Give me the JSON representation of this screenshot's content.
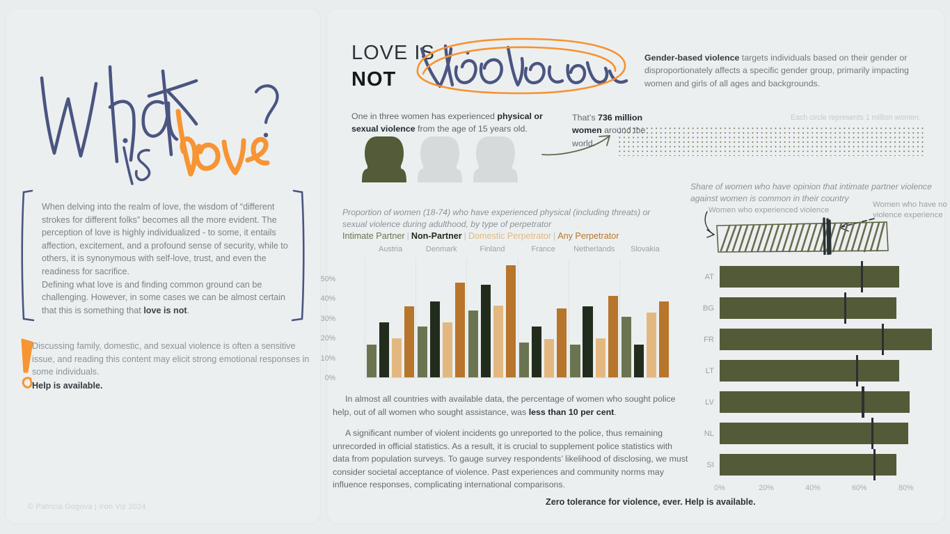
{
  "left_panel": {
    "headline_words": [
      "What",
      "is",
      "love?"
    ],
    "body_paragraph_1": "When delving into the realm of love, the wisdom of “different strokes for different folks” becomes all the more evident. The perception of love is highly individualized - to some, it entails affection, excitement, and a profound sense of security, while to others, it is synonymous with self-love, trust, and even the readiness for sacrifice.",
    "body_paragraph_2_lead": "Defining what love is and finding common ground can be challenging. However, in some cases we can be almost certain that this is something that ",
    "body_paragraph_2_bold": "love is not",
    "body_paragraph_2_tail": ".",
    "warning_text": "Discussing family, domestic, and sexual violence is often a sensitive issue, and reading this content may elicit strong emotional responses in some individuals.",
    "warning_strong": "Help is available.",
    "credit": "© Patricia Gogova | Iron Viz 2024"
  },
  "header": {
    "title_line1": "LOVE IS",
    "title_line2": "NOT",
    "title_script": "violence",
    "gbv_bold": "Gender-based violence",
    "gbv_rest": " targets individuals based on their gender or disproportionately affects a specific gender group, primarily impacting women and girls of all ages and backgrounds."
  },
  "stat_block": {
    "line_lead": "One in three women has experienced ",
    "line_bold": "physical or sexual violence",
    "line_tail": " from the age of 15 years old.",
    "millions_lead": "That’s ",
    "millions_bold": "736 million women",
    "millions_tail": " around the world.",
    "dotgrid_caption": "Each circle represents 1 million women.",
    "figures_total": 3,
    "figures_highlighted": 1
  },
  "bar_section": {
    "subtitle": "Proportion of women (18-74) who have experienced physical (including threats) or sexual violence during adulthood, by type of perpetrator",
    "legend": [
      "Intimate Partner",
      "Non-Partner",
      "Domestic Perpetrator",
      "Any Perpetrator"
    ],
    "legend_colors": [
      "#6b7450",
      "#222c1c",
      "#e3b880",
      "#b8752c"
    ]
  },
  "mid_text": {
    "p1_lead": "In almost all countries with available data, the percentage of women who sought police help, out of all women who sought assistance, was ",
    "p1_bold": "less than 10 per cent",
    "p1_tail": ".",
    "p2": "A significant number of violent incidents go unreported to the police, thus remaining unrecorded in official statistics. As a result, it is crucial to supplement police statistics with data from population surveys. To gauge survey respondents’ likelihood of disclosing, we must consider societal acceptance of violence. Past experiences and community norms may influence responses, complicating international comparisons.",
    "footer": "Zero tolerance for violence, ever. Help is available."
  },
  "bullet_section": {
    "subtitle": "Share of women who have opinion that intimate partner violence against women is common in their country",
    "label_left": "Women who experienced violence",
    "label_right": "Women who have no violence experience"
  },
  "chart_data": [
    {
      "type": "bar",
      "title": "Proportion of women (18-74) who have experienced physical (including threats) or sexual violence during adulthood, by type of perpetrator",
      "xlabel": "",
      "ylabel": "",
      "ylim": [
        0,
        60
      ],
      "ytick_labels": [
        "0%",
        "10%",
        "20%",
        "30%",
        "40%",
        "50%"
      ],
      "ytick_values": [
        0,
        10,
        20,
        30,
        40,
        50
      ],
      "grid": false,
      "legend_position": "top",
      "categories": [
        "Austria",
        "Denmark",
        "Finland",
        "France",
        "Netherlands",
        "Slovakia"
      ],
      "series": [
        {
          "name": "Intimate Partner",
          "color": "#6b7450",
          "values": [
            17,
            26,
            34,
            18,
            17,
            31
          ]
        },
        {
          "name": "Non-Partner",
          "color": "#222c1c",
          "values": [
            28,
            38.5,
            47,
            26,
            36,
            17
          ]
        },
        {
          "name": "Domestic Perpetrator",
          "color": "#e3b880",
          "values": [
            20,
            28,
            36.5,
            19.5,
            20,
            33
          ]
        },
        {
          "name": "Any Perpetrator",
          "color": "#b8752c",
          "values": [
            36,
            48,
            57,
            35,
            41.5,
            38.5
          ]
        }
      ]
    },
    {
      "type": "bar",
      "orientation": "horizontal",
      "title": "Share of women who have opinion that intimate partner violence against women is common in their country",
      "xlim": [
        0,
        95
      ],
      "xtick_labels": [
        "0%",
        "20%",
        "40%",
        "60%",
        "80%"
      ],
      "xtick_values": [
        0,
        20,
        40,
        60,
        80
      ],
      "grid": false,
      "categories": [
        "AT",
        "BG",
        "FR",
        "LT",
        "LV",
        "NL",
        "SI"
      ],
      "series": [
        {
          "name": "Women who experienced violence",
          "color": "#535a38",
          "values": [
            77,
            76,
            91,
            77,
            81.5,
            81,
            76
          ]
        },
        {
          "name": "Women who have no violence experience",
          "color": "#2b3033",
          "marker": true,
          "values": [
            60.5,
            53.5,
            69.5,
            58.5,
            61,
            65,
            66
          ]
        }
      ]
    }
  ]
}
